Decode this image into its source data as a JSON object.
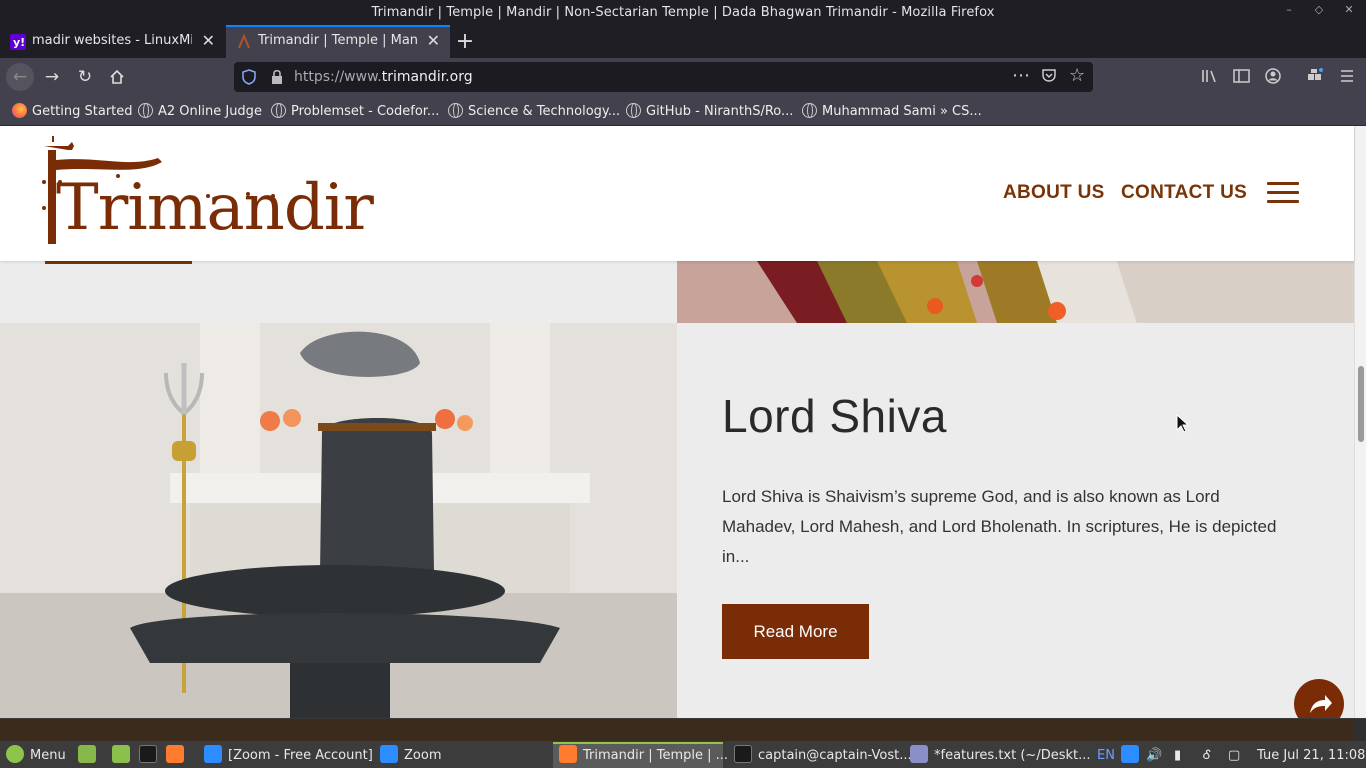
{
  "window": {
    "title": "Trimandir | Temple | Mandir | Non-Sectarian Temple | Dada Bhagwan Trimandir - Mozilla Firefox"
  },
  "tabs": [
    {
      "label": "madir websites - LinuxMint",
      "favicon": "yahoo-icon",
      "active": false
    },
    {
      "label": "Trimandir | Temple | Mandir",
      "favicon": "trimandir-icon",
      "active": true
    }
  ],
  "urlbar": {
    "prefix": "https://www.",
    "domain": "trimandir.org"
  },
  "bookmarks": [
    {
      "label": "Getting Started",
      "icon": "firefox-icon"
    },
    {
      "label": "A2 Online Judge",
      "icon": "globe-icon"
    },
    {
      "label": "Problemset - Codefor...",
      "icon": "globe-icon"
    },
    {
      "label": "Science & Technology...",
      "icon": "globe-icon"
    },
    {
      "label": "GitHub - NiranthS/Ro...",
      "icon": "globe-icon"
    },
    {
      "label": "Muhammad Sami » CS...",
      "icon": "globe-icon"
    }
  ],
  "site": {
    "logo": "Trimandir",
    "nav": {
      "about": "ABOUT US",
      "contact": "CONTACT US"
    },
    "card": {
      "title": "Lord Shiva",
      "text": "Lord Shiva is Shaivism’s supreme God, and is also known as Lord Mahadev, Lord Mahesh, and Lord Bholenath. In scriptures, He is depicted in...",
      "button": "Read More"
    },
    "colors": {
      "brand": "#7a2c06",
      "background": "#ececec"
    }
  },
  "taskbar": {
    "menu": "Menu",
    "items": [
      {
        "label": "[Zoom - Free Account]"
      },
      {
        "label": "Zoom"
      },
      {
        "label": "Trimandir | Temple | ...",
        "active": true
      },
      {
        "label": "captain@captain-Vost..."
      },
      {
        "label": "*features.txt (~/Deskt..."
      }
    ],
    "lang": "EN",
    "clock": "Tue Jul 21, 11:08"
  }
}
